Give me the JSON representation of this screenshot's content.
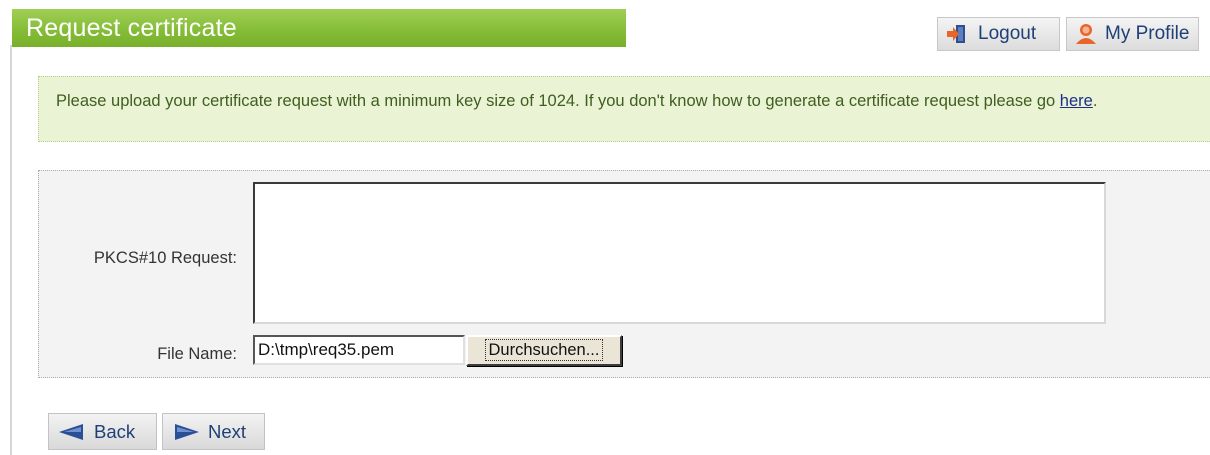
{
  "header": {
    "title": "Request certificate",
    "logout_label": "Logout",
    "profile_label": "My Profile"
  },
  "info": {
    "text": "Please upload your certificate request with a minimum key size of 1024. If you don't know how to generate a certificate request please go ",
    "link_label": "here",
    "suffix": "."
  },
  "form": {
    "request_label": "PKCS#10 Request:",
    "request_value": "",
    "file_label": "File Name:",
    "file_value": "D:\\tmp\\req35.pem",
    "browse_label": "Durchsuchen..."
  },
  "nav": {
    "back_label": "Back",
    "next_label": "Next"
  },
  "icons": {
    "logout": "logout-arrow-icon",
    "profile": "user-profile-icon",
    "back": "arrow-left-icon",
    "next": "arrow-right-icon"
  },
  "colors": {
    "title_green": "#86bd38",
    "info_bg": "#eaf3d4",
    "link_blue": "#1f3f77",
    "icon_orange": "#e8662b"
  }
}
